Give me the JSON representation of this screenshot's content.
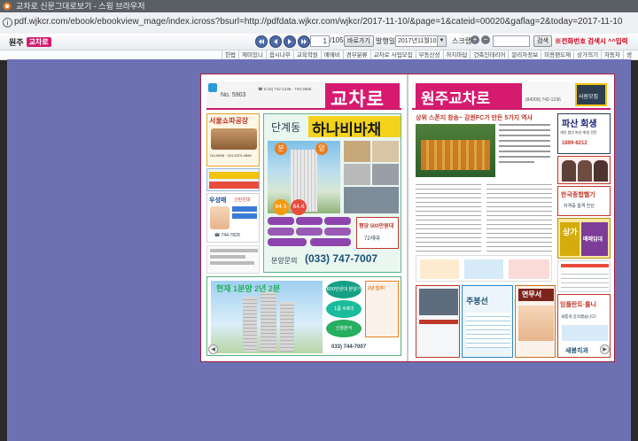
{
  "window": {
    "title": "교차로 신문그대로보기 - 스윙 브라우저",
    "url": "pdf.wjkcr.com/ebook/ebookview_mage/index.icross?bsurl=http://pdfdata.wjkcr.com/wjkcr/2017-11-10/&page=1&cateid=00020&gaflag=2&today=2017-11-10"
  },
  "toolbar": {
    "home_label": "원주",
    "logo_label": "교차로",
    "page_current": "1",
    "page_total": "/105",
    "go_label": "바로가기",
    "issue_date_label": "발행일",
    "issue_date_value": "2017년11월10일",
    "zoom_label": "스크랩",
    "search_button_label": "검색",
    "notice": "※전화번호 검색시 ^^입력"
  },
  "categories": [
    "헌법",
    "재미있니",
    "옵시나무",
    "교육학원",
    "매매비",
    "경부분류",
    "교차로 사업모집",
    "부동산성",
    "하지마답",
    "건축인테리어",
    "알리자정보",
    "미용편도재",
    "상가의기",
    "자동차",
    "생"
  ],
  "left_page": {
    "masthead": "교차로",
    "issue_no": "No. 5903",
    "phone_line": "☎ 0.33) 742-1236 · 742-2555",
    "ad1_title": "서울쇼파공장",
    "ad1_phone": "744-0898 · 010-5379-0898",
    "ad2_title": "우성매",
    "ad2_sub": "신탄진대",
    "dental_phone": "☎ 744-7828",
    "hero_sub": "단계동",
    "hero_title": "하나비바채",
    "hero_badge1": "분",
    "hero_badge2": "양",
    "price_area": "94.5",
    "price_unit": "84.6",
    "promo_price": "평당 500만원대",
    "promo_sub": "72세대",
    "hotline_label": "분양문의",
    "hotline_number": "(033) 747-7007",
    "bottom_ad_title": "현재 1분양 2년 2분",
    "bottom_ad_1": "600만원대 분양가",
    "bottom_ad_2": "1룸 4세대",
    "bottom_ad_3": "신정분석",
    "bottom_ad_4": "2년 입주!",
    "bottom_phone": "033) 744-7007"
  },
  "right_page": {
    "masthead": "원주교차로",
    "issue_badge": "사원모집",
    "contact": "(84209) 742-1236",
    "headline": "상위 스폰지 창송~ 감원FC가 만든 5가지 역사",
    "side_ad_title": "파산 회생",
    "side_ad_sub": "개인·법인 파산·회생 전문",
    "side_ad_phone": "1899-6212",
    "side_ad2": "한국종합헬기",
    "side_ad2_sub": "자격증 합격 진단",
    "side_ad3_line1": "상가",
    "side_ad3_line2": "매매임대",
    "bottom_ad_title": "주봉선",
    "bottom_ad_badge": "면무서",
    "right_bottom_title": "임플란트·틀니",
    "right_bottom_sub": "새롭게 강의했습니다!",
    "right_bottom_footer": "새봉치과"
  },
  "colors": {
    "stage": "#6d71b3",
    "brand_pink": "#d61a70",
    "frame_red": "#a0203a",
    "nav_blue": "#4c6aa6"
  }
}
